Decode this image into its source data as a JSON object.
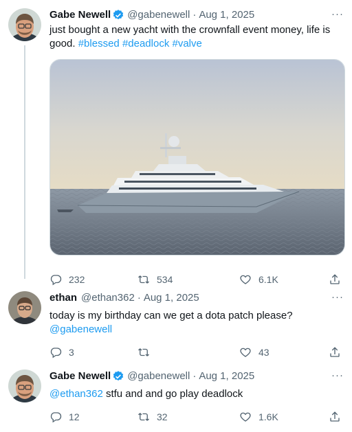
{
  "tweets": [
    {
      "author": "Gabe Newell",
      "handle": "@gabenewell",
      "separator": "·",
      "date": "Aug 1, 2025",
      "text": "just bought a new yacht with the crownfall event money, life is good.",
      "hashtags": [
        "#blessed",
        "#deadlock",
        "#valve"
      ],
      "verified": true,
      "media": "yacht-photo",
      "stats": {
        "replies": "232",
        "retweets": "534",
        "likes": "6.1K"
      }
    },
    {
      "author": "ethan",
      "handle": "@ethan362",
      "separator": "·",
      "date": "Aug 1, 2025",
      "text": "today is my birthday can we get a dota patch please?",
      "mention": "@gabenewell",
      "verified": false,
      "stats": {
        "replies": "3",
        "retweets": "",
        "likes": "43"
      }
    },
    {
      "author": "Gabe Newell",
      "handle": "@gabenewell",
      "separator": "·",
      "date": "Aug 1, 2025",
      "mention": "@ethan362",
      "text": " stfu and and go play deadlock",
      "verified": true,
      "stats": {
        "replies": "12",
        "retweets": "32",
        "likes": "1.6K"
      }
    }
  ],
  "more_label": "···",
  "colors": {
    "link": "#1d9bf0",
    "muted": "#536471",
    "text": "#0f1419",
    "verified": "#1d9bf0"
  }
}
